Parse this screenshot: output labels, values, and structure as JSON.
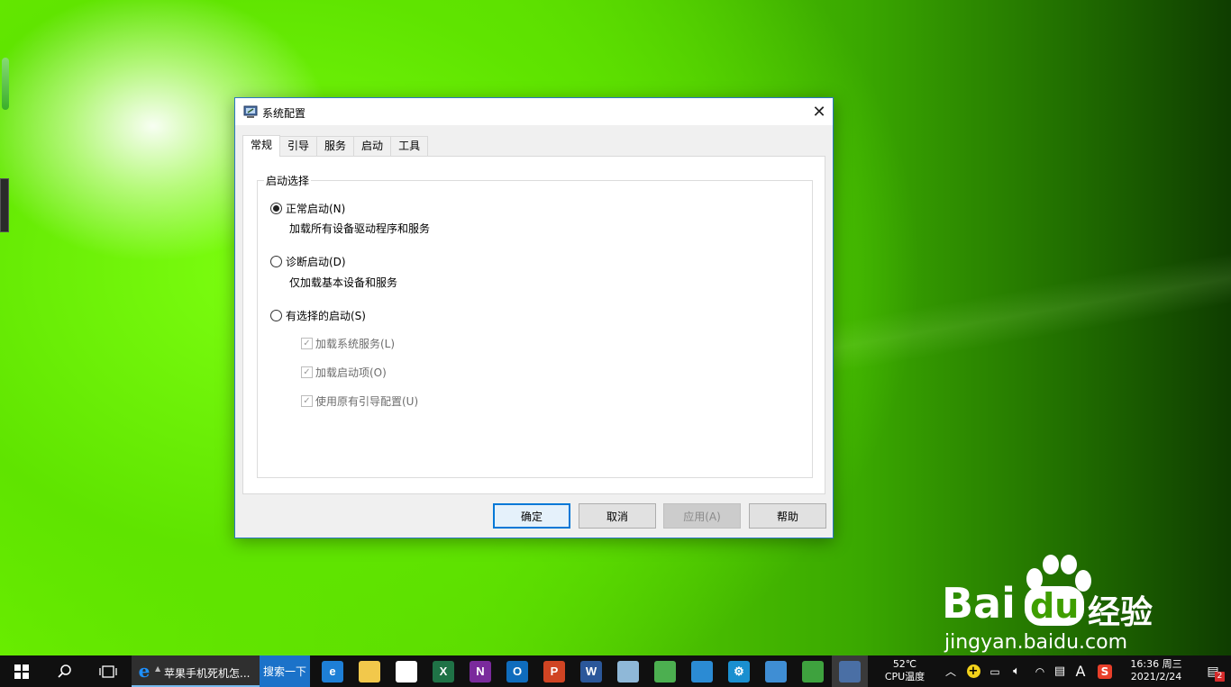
{
  "dialog": {
    "title": "系统配置",
    "tabs": [
      {
        "label": "常规",
        "active": true
      },
      {
        "label": "引导",
        "active": false
      },
      {
        "label": "服务",
        "active": false
      },
      {
        "label": "启动",
        "active": false
      },
      {
        "label": "工具",
        "active": false
      }
    ],
    "group_title": "启动选择",
    "options": [
      {
        "label": "正常启动(N)",
        "description": "加载所有设备驱动程序和服务",
        "selected": true
      },
      {
        "label": "诊断启动(D)",
        "description": "仅加载基本设备和服务",
        "selected": false
      },
      {
        "label": "有选择的启动(S)",
        "selected": false
      }
    ],
    "selective_items": [
      {
        "label": "加载系统服务(L)",
        "checked": true,
        "enabled": false
      },
      {
        "label": "加载启动项(O)",
        "checked": true,
        "enabled": false
      },
      {
        "label": "使用原有引导配置(U)",
        "checked": true,
        "enabled": false
      }
    ],
    "buttons": {
      "ok": "确定",
      "cancel": "取消",
      "apply": "应用(A)",
      "help": "帮助"
    }
  },
  "taskbar": {
    "ie_task_label": "苹果手机死机怎...",
    "search_button": "搜索一下",
    "apps": [
      {
        "name": "edge-icon",
        "glyph": "e",
        "color": "#1e7fd6"
      },
      {
        "name": "file-explorer-icon",
        "glyph": "",
        "color": "#f2c84b"
      },
      {
        "name": "store-icon",
        "glyph": "",
        "color": "#ffffff"
      },
      {
        "name": "excel-icon",
        "glyph": "X",
        "color": "#1f7246"
      },
      {
        "name": "onenote-icon",
        "glyph": "N",
        "color": "#7a2a9c"
      },
      {
        "name": "outlook-icon",
        "glyph": "O",
        "color": "#0f6cbd"
      },
      {
        "name": "powerpoint-icon",
        "glyph": "P",
        "color": "#d04423"
      },
      {
        "name": "word-icon",
        "glyph": "W",
        "color": "#2b579a"
      },
      {
        "name": "paint-icon",
        "glyph": "",
        "color": "#8fb8d8"
      },
      {
        "name": "green-app-icon",
        "glyph": "",
        "color": "#4caf50"
      },
      {
        "name": "network-app-icon",
        "glyph": "",
        "color": "#2b8bd4"
      },
      {
        "name": "settings-app-icon",
        "glyph": "⚙",
        "color": "#1a8fd0"
      },
      {
        "name": "remote-app-icon",
        "glyph": "",
        "color": "#3f8ed4"
      },
      {
        "name": "photo-app-icon",
        "glyph": "",
        "color": "#3ea23e"
      },
      {
        "name": "msconfig-app-icon",
        "glyph": "",
        "color": "#4a6fa5"
      }
    ],
    "temperature": "52℃",
    "temperature_label": "CPU温度",
    "ime_indicator": "A",
    "time": "16:36 周三",
    "date": "2021/2/24",
    "notification_count": "2"
  },
  "watermark": {
    "brand": "Bai",
    "brand2": "du",
    "product": "经验",
    "url": "jingyan.baidu.com"
  }
}
